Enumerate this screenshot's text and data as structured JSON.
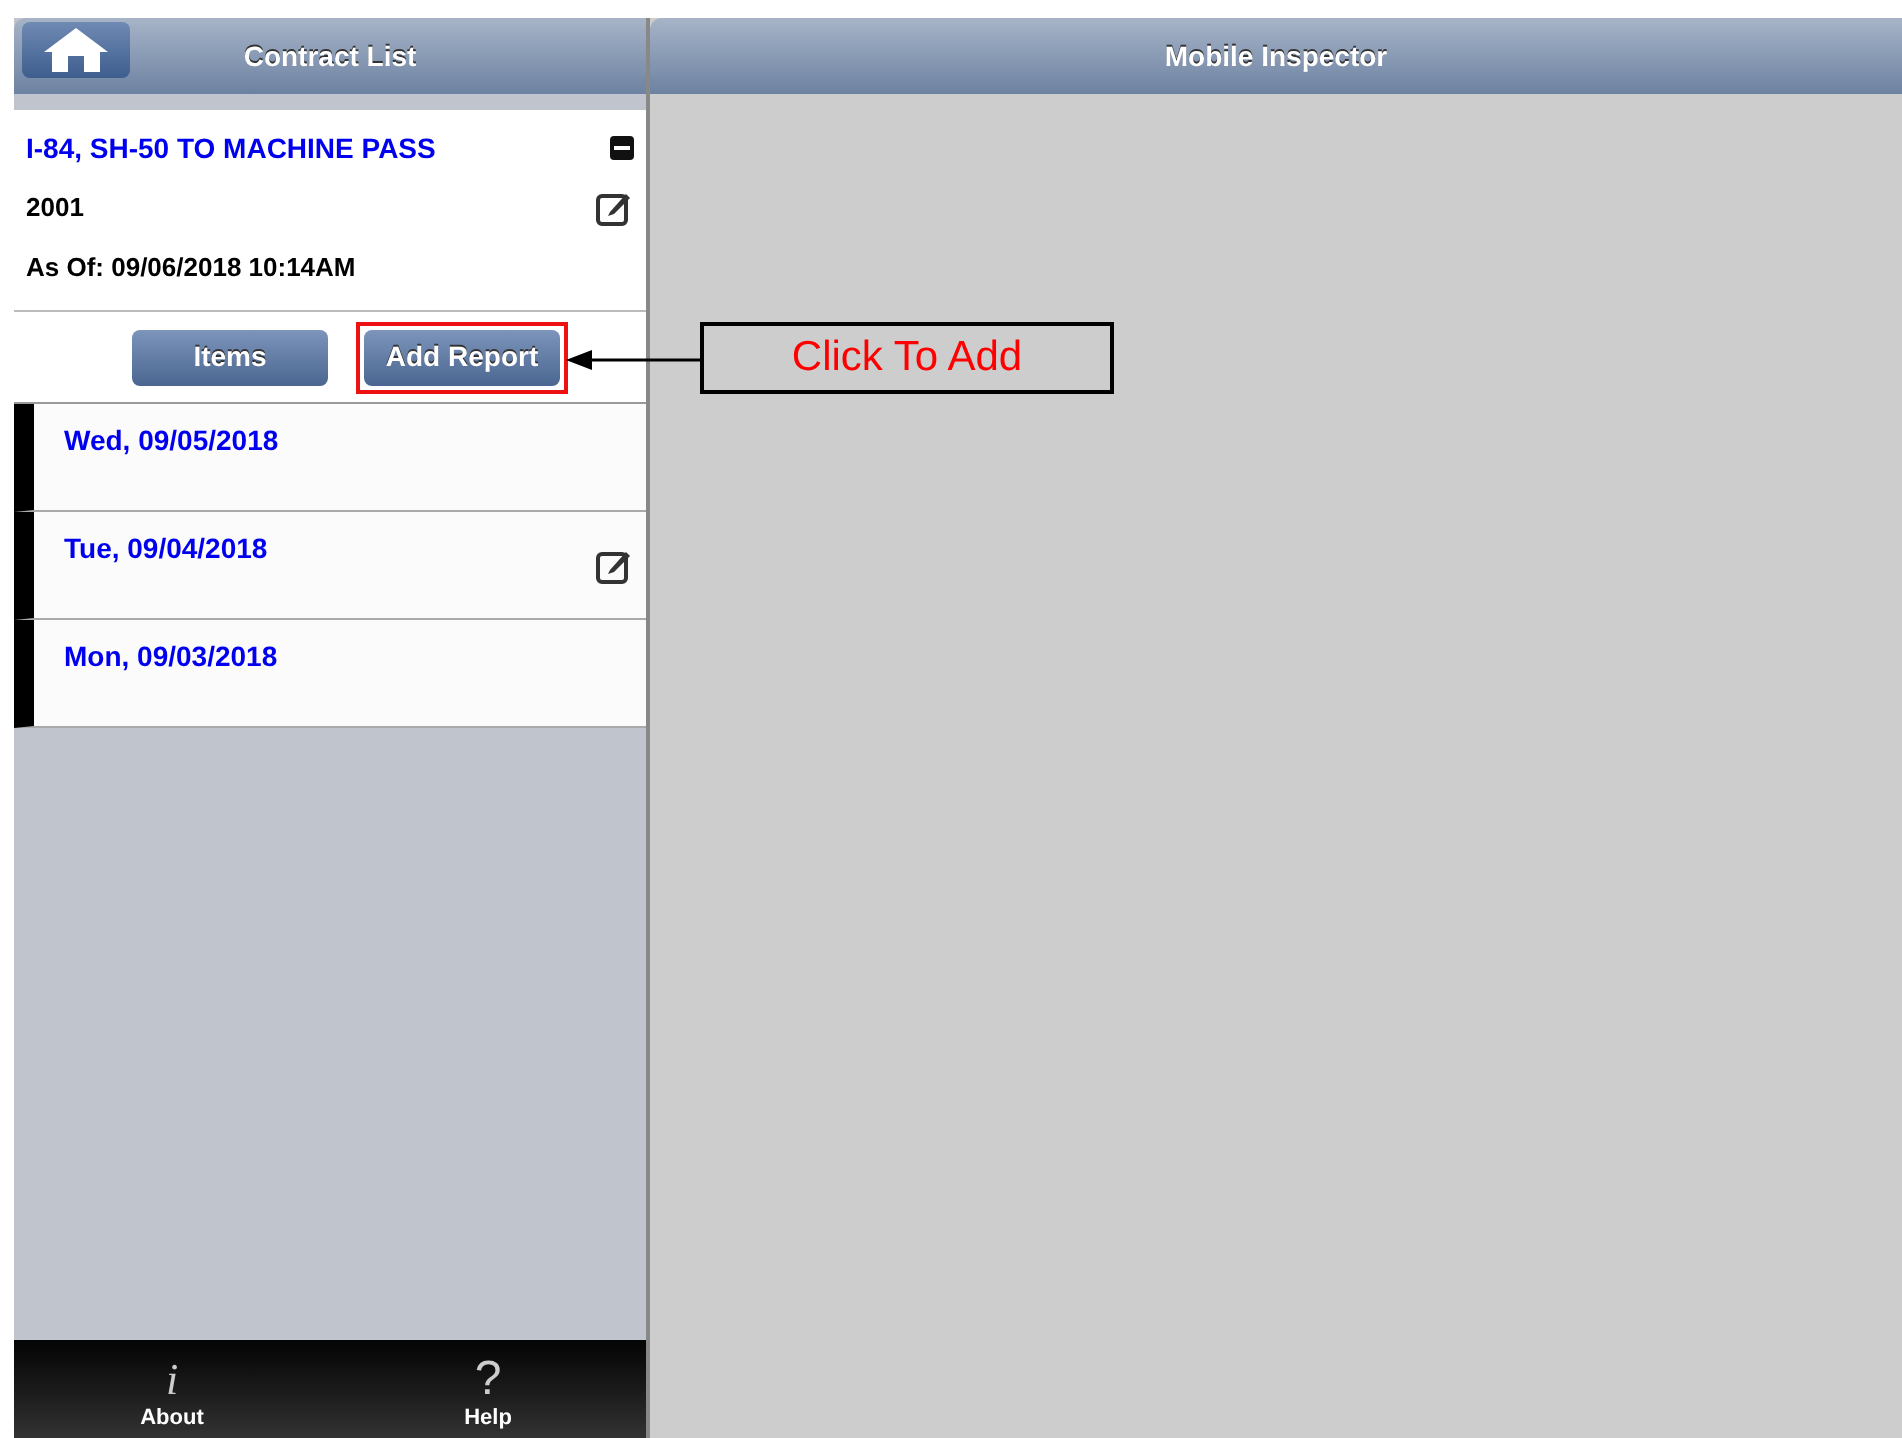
{
  "left_header": {
    "title": "Contract List"
  },
  "right_header": {
    "title": "Mobile Inspector"
  },
  "contract": {
    "title": "I-84, SH-50 TO MACHINE PASS",
    "expanded": true,
    "number": "2001",
    "edited": true,
    "as_of": "As Of: 09/06/2018 10:14AM"
  },
  "buttons": [
    {
      "label": "Items",
      "highlighted": false
    },
    {
      "label": "Add Report",
      "highlighted": true
    }
  ],
  "reports": [
    {
      "date": "Wed, 09/05/2018",
      "edited": false
    },
    {
      "date": "Tue, 09/04/2018",
      "edited": true
    },
    {
      "date": "Mon, 09/03/2018",
      "edited": false
    }
  ],
  "footer": [
    {
      "kind": "info",
      "icon": "i",
      "label": "About"
    },
    {
      "kind": "help",
      "icon": "?",
      "label": "Help"
    }
  ],
  "callout": {
    "text": "Click To Add"
  }
}
